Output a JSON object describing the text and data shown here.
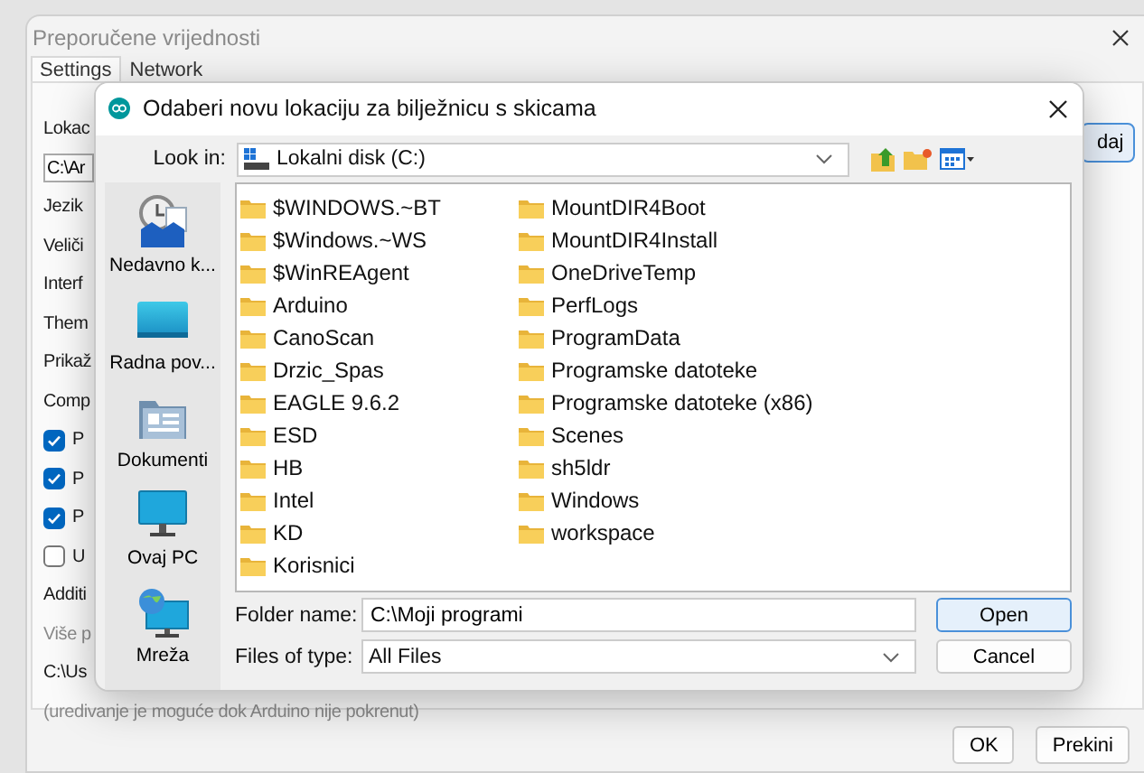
{
  "background_window": {
    "title": "Preporučene vrijednosti",
    "tabs": [
      {
        "label": "Settings",
        "selected": true
      },
      {
        "label": "Network",
        "selected": false
      }
    ],
    "rows": [
      {
        "kind": "label",
        "text": "Lokac"
      },
      {
        "kind": "field",
        "text": "C:\\Ar"
      },
      {
        "kind": "label",
        "text": "Jezik"
      },
      {
        "kind": "label",
        "text": "Veliči"
      },
      {
        "kind": "label",
        "text": "Interf"
      },
      {
        "kind": "label",
        "text": "Them"
      },
      {
        "kind": "label",
        "text": "Prikaž"
      },
      {
        "kind": "label",
        "text": "Comp"
      },
      {
        "kind": "checkbox",
        "text": "P",
        "checked": true
      },
      {
        "kind": "checkbox",
        "text": "P",
        "checked": true
      },
      {
        "kind": "checkbox",
        "text": "P",
        "checked": true
      },
      {
        "kind": "checkbox",
        "text": "U",
        "checked": false
      },
      {
        "kind": "label",
        "text": "Additi"
      },
      {
        "kind": "hint",
        "text": "Više p"
      },
      {
        "kind": "label",
        "text": "C:\\Us"
      },
      {
        "kind": "hint",
        "text": "(uredivanje je moguće dok Arduino nije pokrenut)"
      }
    ],
    "side_button": "daj",
    "buttons": [
      "OK",
      "Prekini"
    ]
  },
  "dialog": {
    "title": "Odaberi novu lokaciju za bilježnicu s skicama",
    "look_in_label": "Look in:",
    "look_in_value": "Lokalni disk (C:)",
    "places": [
      {
        "kind": "recent",
        "label": "Nedavno k..."
      },
      {
        "kind": "desktop",
        "label": "Radna pov..."
      },
      {
        "kind": "documents",
        "label": "Dokumenti"
      },
      {
        "kind": "pc",
        "label": "Ovaj PC"
      },
      {
        "kind": "network",
        "label": "Mreža"
      }
    ],
    "folders": [
      "$WINDOWS.~BT",
      "$Windows.~WS",
      "$WinREAgent",
      "Arduino",
      "CanoScan",
      "Drzic_Spas",
      "EAGLE 9.6.2",
      "ESD",
      "HB",
      "Intel",
      "KD",
      "Korisnici",
      "MountDIR4Boot",
      "MountDIR4Install",
      "OneDriveTemp",
      "PerfLogs",
      "ProgramData",
      "Programske datoteke",
      "Programske datoteke (x86)",
      "Scenes",
      "sh5ldr",
      "Windows",
      "workspace"
    ],
    "folder_name_label": "Folder name:",
    "folder_name_value": "C:\\Moji programi",
    "files_of_type_label": "Files of type:",
    "files_of_type_value": "All Files",
    "buttons": [
      "Open",
      "Cancel"
    ]
  }
}
